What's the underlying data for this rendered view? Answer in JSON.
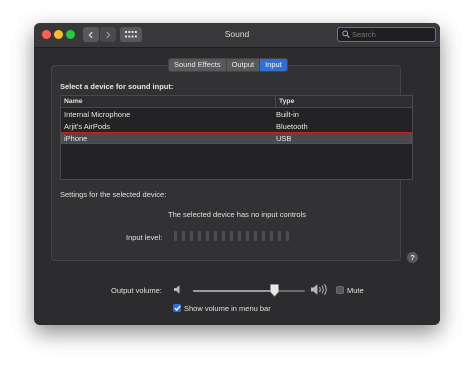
{
  "window": {
    "title": "Sound",
    "search": {
      "placeholder": "Search",
      "value": ""
    },
    "accent_color": "#2f6fd8",
    "selection_outline_color": "#d21d1d"
  },
  "tabs": [
    {
      "label": "Sound Effects",
      "active": false
    },
    {
      "label": "Output",
      "active": false
    },
    {
      "label": "Input",
      "active": true
    }
  ],
  "input": {
    "heading": "Select a device for sound input:",
    "columns": [
      "Name",
      "Type"
    ],
    "devices": [
      {
        "name": "Internal Microphone",
        "type": "Built-in",
        "selected": false
      },
      {
        "name": "Arjit's AirPods",
        "type": "Bluetooth",
        "selected": false
      },
      {
        "name": "iPhone",
        "type": "USB",
        "selected": true
      }
    ],
    "settings_label": "Settings for the selected device:",
    "no_controls_message": "The selected device has no input controls",
    "input_level_label": "Input level:",
    "input_level_segments": 15,
    "input_level_value": 0,
    "help_label": "?"
  },
  "output": {
    "volume_label": "Output volume:",
    "volume_fraction": 0.73,
    "mute_label": "Mute",
    "mute_checked": false,
    "show_in_menubar_label": "Show volume in menu bar",
    "show_in_menubar_checked": true
  },
  "icons": {
    "back": "chevron-left-icon",
    "forward": "chevron-right-icon",
    "grid": "grid-icon",
    "search": "search-icon",
    "speaker_low": "speaker-low-icon",
    "speaker_high": "speaker-high-icon"
  }
}
